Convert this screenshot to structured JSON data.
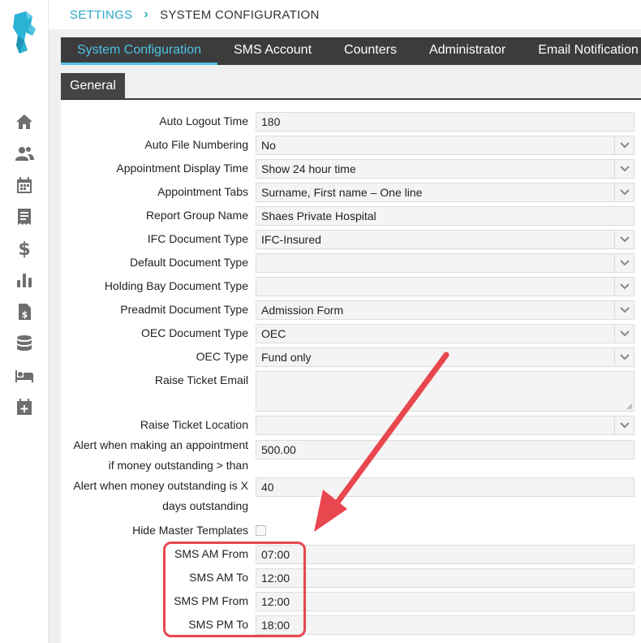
{
  "breadcrumb": {
    "parent": "SETTINGS",
    "separator": "›",
    "current": "SYSTEM CONFIGURATION"
  },
  "tabs": [
    "System Configuration",
    "SMS Account",
    "Counters",
    "Administrator",
    "Email Notification"
  ],
  "subtab": "General",
  "sidebar_icons": [
    "home-icon",
    "users-icon",
    "calendar-icon",
    "invoice-icon",
    "dollar-icon",
    "bar-chart-icon",
    "billing-document-icon",
    "database-icon",
    "bed-icon",
    "calendar-plus-icon"
  ],
  "form": {
    "auto_logout_time": {
      "label": "Auto Logout Time",
      "value": "180"
    },
    "auto_file_numbering": {
      "label": "Auto File Numbering",
      "value": "No"
    },
    "appointment_display_time": {
      "label": "Appointment Display Time",
      "value": "Show 24 hour time"
    },
    "appointment_tabs": {
      "label": "Appointment Tabs",
      "value": "Surname, First name – One line"
    },
    "report_group_name": {
      "label": "Report Group Name",
      "value": "Shaes Private Hospital"
    },
    "ifc_document_type": {
      "label": "IFC Document Type",
      "value": "IFC-Insured"
    },
    "default_document_type": {
      "label": "Default Document Type",
      "value": ""
    },
    "holding_bay_document_type": {
      "label": "Holding Bay Document Type",
      "value": ""
    },
    "preadmit_document_type": {
      "label": "Preadmit Document Type",
      "value": "Admission Form"
    },
    "oec_document_type": {
      "label": "OEC Document Type",
      "value": "OEC"
    },
    "oec_type": {
      "label": "OEC Type",
      "value": "Fund only"
    },
    "raise_ticket_email": {
      "label": "Raise Ticket Email",
      "value": ""
    },
    "raise_ticket_location": {
      "label": "Raise Ticket Location",
      "value": ""
    },
    "alert_appointment": {
      "label_line1": "Alert when making an appointment",
      "label_line2": "if money outstanding > than",
      "value": "500.00"
    },
    "alert_outstanding_days": {
      "label_line1": "Alert when money outstanding is X",
      "label_line2": "days outstanding",
      "value": "40"
    },
    "hide_master_templates": {
      "label": "Hide Master Templates",
      "checked": false
    },
    "sms_am_from": {
      "label": "SMS AM From",
      "value": "07:00"
    },
    "sms_am_to": {
      "label": "SMS AM To",
      "value": "12:00"
    },
    "sms_pm_from": {
      "label": "SMS PM From",
      "value": "12:00"
    },
    "sms_pm_to": {
      "label": "SMS PM To",
      "value": "18:00"
    }
  },
  "colors": {
    "accent": "#29a8c6",
    "tab_active": "#4fc3e8",
    "tabbar": "#3c3c3c",
    "annotation": "#e8474f"
  }
}
